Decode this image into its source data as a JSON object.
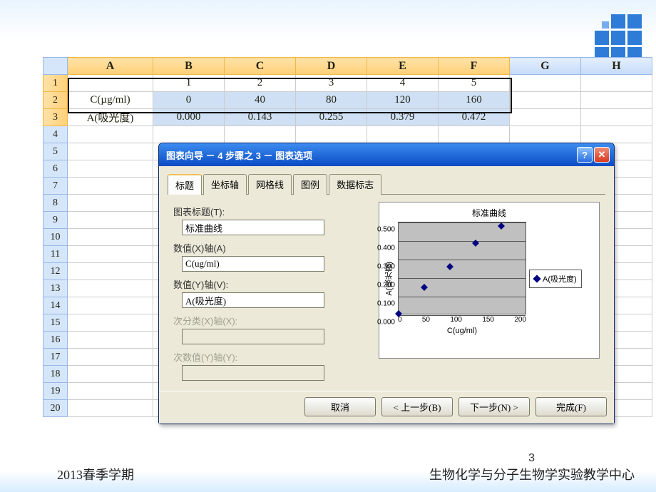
{
  "spreadsheet": {
    "col_headers": [
      "A",
      "B",
      "C",
      "D",
      "E",
      "F",
      "G",
      "H"
    ],
    "rows": [
      {
        "n": "1",
        "cells": [
          "",
          "1",
          "2",
          "3",
          "4",
          "5",
          "",
          ""
        ]
      },
      {
        "n": "2",
        "cells": [
          "C(µg/ml)",
          "0",
          "40",
          "80",
          "120",
          "160",
          "",
          ""
        ]
      },
      {
        "n": "3",
        "cells": [
          "A(吸光度)",
          "0.000",
          "0.143",
          "0.255",
          "0.379",
          "0.472",
          "",
          ""
        ]
      },
      {
        "n": "4"
      },
      {
        "n": "5"
      },
      {
        "n": "6"
      },
      {
        "n": "7"
      },
      {
        "n": "8"
      },
      {
        "n": "9"
      },
      {
        "n": "10"
      },
      {
        "n": "11"
      },
      {
        "n": "12"
      },
      {
        "n": "13"
      },
      {
        "n": "14"
      },
      {
        "n": "15"
      },
      {
        "n": "16"
      },
      {
        "n": "17"
      },
      {
        "n": "18"
      },
      {
        "n": "19"
      },
      {
        "n": "20"
      }
    ]
  },
  "dialog": {
    "title": "图表向导 － 4 步骤之 3 － 图表选项",
    "tabs": [
      "标题",
      "坐标轴",
      "网格线",
      "图例",
      "数据标志"
    ],
    "active_tab": "标题",
    "labels": {
      "chart_title": "图表标题(T):",
      "x_axis": "数值(X)轴(A)",
      "y_axis": "数值(Y)轴(V):",
      "x2_axis": "次分类(X)轴(X):",
      "y2_axis": "次数值(Y)轴(Y):"
    },
    "values": {
      "chart_title": "标准曲线",
      "x_axis": "C(ug/ml)",
      "y_axis": "A(吸光度)"
    },
    "buttons": {
      "cancel": "取消",
      "back": "< 上一步(B)",
      "next": "下一步(N) >",
      "finish": "完成(F)"
    }
  },
  "chart_data": {
    "type": "scatter",
    "title": "标准曲线",
    "xlabel": "C(ug/ml)",
    "ylabel": "A(吸光度)",
    "xlim": [
      0,
      200
    ],
    "ylim": [
      0,
      0.5
    ],
    "xticks": [
      0,
      50,
      100,
      150,
      200
    ],
    "yticks": [
      0.0,
      0.1,
      0.2,
      0.3,
      0.4,
      0.5
    ],
    "series": [
      {
        "name": "A(吸光度)",
        "x": [
          0,
          40,
          80,
          120,
          160
        ],
        "y": [
          0.0,
          0.143,
          0.255,
          0.379,
          0.472
        ]
      }
    ]
  },
  "footer": {
    "left": "2013春季学期",
    "right": "生物化学与分子生物学实验教学中心",
    "page": "3"
  }
}
